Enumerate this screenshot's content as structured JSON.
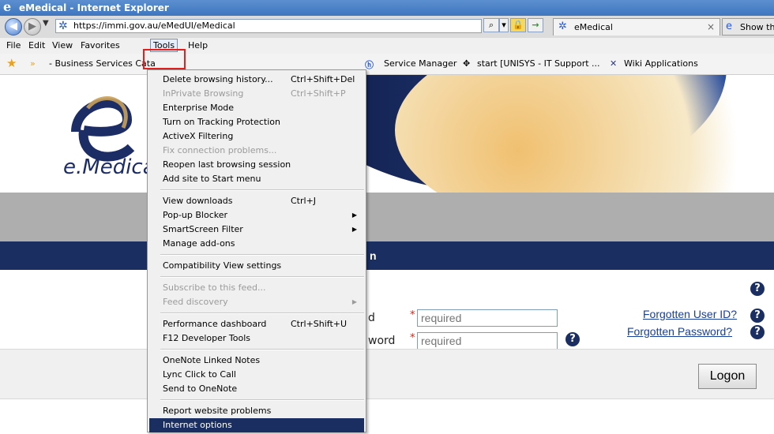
{
  "window": {
    "title": "eMedical - Internet Explorer"
  },
  "address": {
    "url": "https://immi.gov.au/eMedUI/eMedical",
    "search_glyph": "⌕"
  },
  "tabs": [
    {
      "label": "eMedical",
      "close": "×"
    },
    {
      "label": "Show th"
    }
  ],
  "menubar": [
    "File",
    "Edit",
    "View",
    "Favorites",
    "Tools",
    "Help"
  ],
  "favorites": [
    "- Business Services Cata",
    "Service Manager",
    "start [UNISYS - IT Support ...",
    "Wiki Applications"
  ],
  "page": {
    "logo_text": "e.Medical",
    "bar_fragment": "n",
    "login": {
      "user_label_fragment": "d",
      "password_label_fragment": "word",
      "required_marker": "*",
      "user_placeholder": "required",
      "password_placeholder": "required",
      "forgot_user": "Forgotten User ID?",
      "forgot_password": "Forgotten Password?",
      "help_glyph": "?",
      "logon_label": "Logon"
    }
  },
  "tools_menu": {
    "groups": [
      [
        {
          "label": "Delete browsing history...",
          "shortcut": "Ctrl+Shift+Del"
        },
        {
          "label": "InPrivate Browsing",
          "shortcut": "Ctrl+Shift+P",
          "disabled": true
        },
        {
          "label": "Enterprise Mode"
        },
        {
          "label": "Turn on Tracking Protection"
        },
        {
          "label": "ActiveX Filtering"
        },
        {
          "label": "Fix connection problems...",
          "disabled": true
        },
        {
          "label": "Reopen last browsing session"
        },
        {
          "label": "Add site to Start menu"
        }
      ],
      [
        {
          "label": "View downloads",
          "shortcut": "Ctrl+J"
        },
        {
          "label": "Pop-up Blocker",
          "submenu": true
        },
        {
          "label": "SmartScreen Filter",
          "submenu": true
        },
        {
          "label": "Manage add-ons"
        }
      ],
      [
        {
          "label": "Compatibility View settings"
        }
      ],
      [
        {
          "label": "Subscribe to this feed...",
          "disabled": true
        },
        {
          "label": "Feed discovery",
          "disabled": true,
          "submenu": true
        }
      ],
      [
        {
          "label": "Performance dashboard",
          "shortcut": "Ctrl+Shift+U"
        },
        {
          "label": "F12 Developer Tools"
        }
      ],
      [
        {
          "label": "OneNote Linked Notes"
        },
        {
          "label": "Lync Click to Call"
        },
        {
          "label": "Send to OneNote"
        }
      ],
      [
        {
          "label": "Report website problems"
        },
        {
          "label": "Internet options",
          "selected": true
        }
      ]
    ]
  },
  "colors": {
    "accent": "#1a2e61",
    "highlight_box": "#e32020",
    "link": "#1a3e9c"
  }
}
